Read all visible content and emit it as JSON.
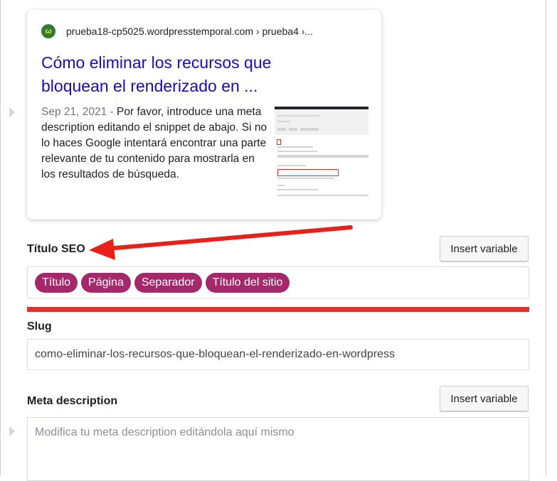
{
  "snippet_preview": {
    "favicon_letter": "ω",
    "url": "prueba18-cp5025.wordpresstemporal.com › prueba4 ›...",
    "title": "Cómo eliminar los recursos que bloquean el renderizado en ...",
    "date": "Sep 21, 2021",
    "separator": " - ",
    "description": "Por favor, introduce una meta description editando el snippet de abajo. Si no lo haces Google intentará encontrar una parte relevante de tu contenido para mostrarla en los resultados de búsqueda."
  },
  "seo_title": {
    "label": "Título SEO",
    "insert_variable": "Insert variable",
    "variables": [
      "Título",
      "Página",
      "Separador",
      "Título del sitio"
    ]
  },
  "progress": {
    "fraction": 1.0,
    "color": "#dc3232"
  },
  "slug": {
    "label": "Slug",
    "value": "como-eliminar-los-recursos-que-bloquean-el-renderizado-en-wordpress"
  },
  "meta_description": {
    "label": "Meta description",
    "insert_variable": "Insert variable",
    "placeholder": "Modifica tu meta description editándola aquí mismo"
  },
  "colors": {
    "pill": "#a4286a",
    "link": "#1a0dab",
    "arrow": "#e8201a"
  }
}
